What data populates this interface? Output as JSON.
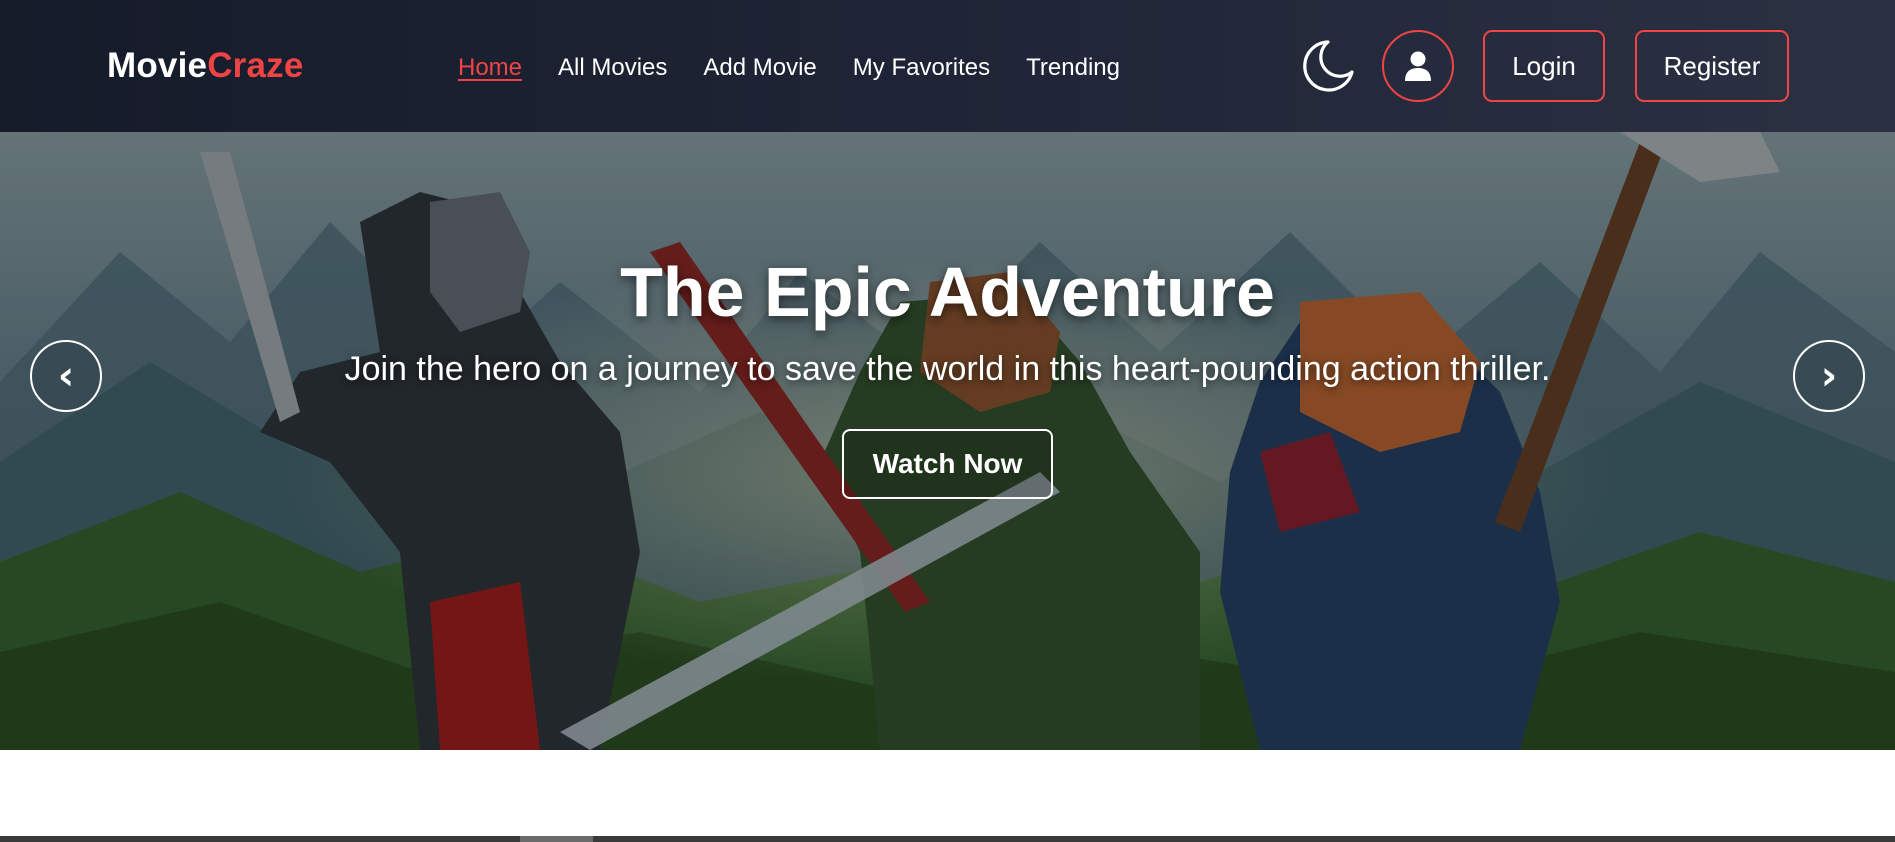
{
  "navbar": {
    "brand_part1": "Movie",
    "brand_part2": "Craze",
    "links": [
      {
        "label": "Home",
        "active": true
      },
      {
        "label": "All Movies",
        "active": false
      },
      {
        "label": "Add Movie",
        "active": false
      },
      {
        "label": "My Favorites",
        "active": false
      },
      {
        "label": "Trending",
        "active": false
      }
    ],
    "theme_icon": "moon-icon",
    "user_icon": "user-icon",
    "login_label": "Login",
    "register_label": "Register"
  },
  "hero": {
    "title": "The Epic Adventure",
    "subtitle": "Join the hero on a journey to save the world in this heart-pounding action thriller.",
    "cta_label": "Watch Now",
    "prev_arrow": "‹",
    "next_arrow": "›"
  },
  "colors": {
    "accent": "#ef4444",
    "navbar_bg": "#1f2536",
    "text": "#ffffff"
  }
}
